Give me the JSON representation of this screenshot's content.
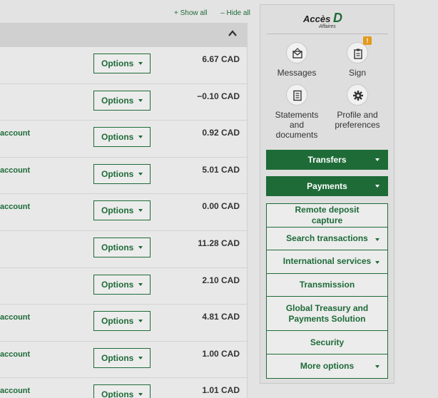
{
  "links": {
    "show_all": "+ Show all",
    "hide_all": "– Hide all"
  },
  "rows": [
    {
      "account": "",
      "option": "Options",
      "amount": "6.67 CAD"
    },
    {
      "account": "",
      "option": "Options",
      "amount": "−0.10 CAD"
    },
    {
      "account": "account",
      "option": "Options",
      "amount": "0.92 CAD"
    },
    {
      "account": "account",
      "option": "Options",
      "amount": "5.01 CAD"
    },
    {
      "account": "account",
      "option": "Options",
      "amount": "0.00 CAD"
    },
    {
      "account": "",
      "option": "Options",
      "amount": "11.28 CAD"
    },
    {
      "account": "",
      "option": "Options",
      "amount": "2.10 CAD"
    },
    {
      "account": "account",
      "option": "Options",
      "amount": "4.81 CAD"
    },
    {
      "account": "account",
      "option": "Options",
      "amount": "1.00 CAD"
    },
    {
      "account": "account",
      "option": "Options",
      "amount": "1.01 CAD"
    }
  ],
  "logo": {
    "main": "Accès",
    "letter": "D",
    "sub": "Affaires"
  },
  "quick_actions": {
    "messages": "Messages",
    "sign": "Sign",
    "sign_badge": "!",
    "statements": "Statements and documents",
    "profile": "Profile and preferences"
  },
  "buttons": {
    "transfers": "Transfers",
    "payments": "Payments"
  },
  "menu": {
    "remote_deposit": "Remote deposit capture",
    "search_transactions": "Search transactions",
    "international": "International services",
    "transmission": "Transmission",
    "global_treasury": "Global Treasury and Payments Solution",
    "security": "Security",
    "more_options": "More options"
  },
  "colors": {
    "brand_green": "#1e6b38",
    "notification": "#e39a1c"
  }
}
